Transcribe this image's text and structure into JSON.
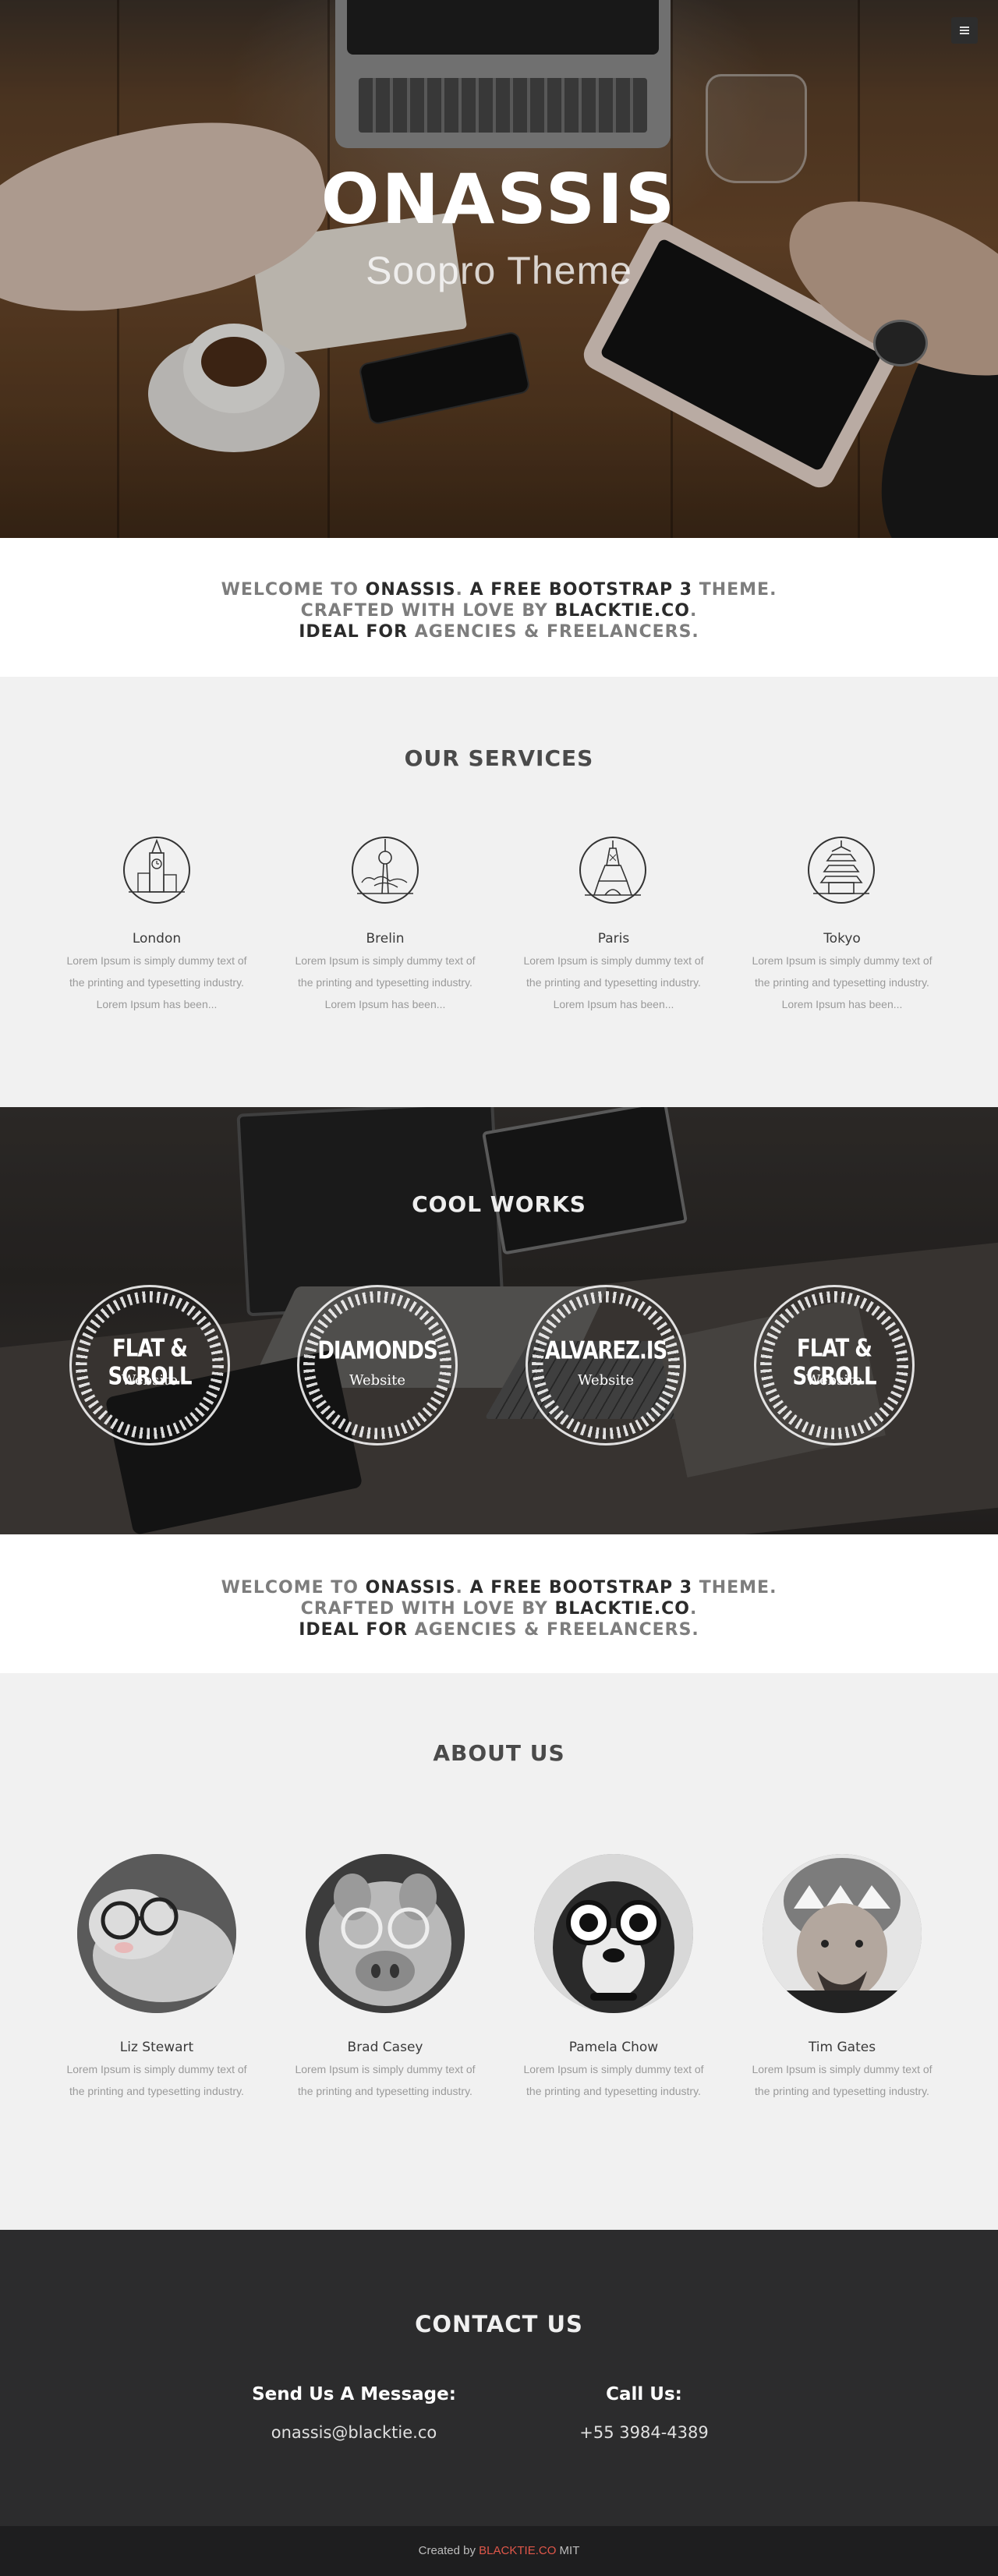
{
  "hero": {
    "title": "ONASSIS",
    "subtitle": "Soopro Theme",
    "menu_icon": "hamburger-icon"
  },
  "welcome": {
    "line1_a": "WELCOME TO ",
    "line1_b": "ONASSIS",
    "line1_c": ". ",
    "line1_d": "A FREE BOOTSTRAP 3",
    "line1_e": " THEME.",
    "line2_a": "CRAFTED WITH LOVE BY ",
    "line2_b": "BLACKTIE.CO",
    "line2_c": ".",
    "line3_a": "IDEAL FOR",
    "line3_b": " AGENCIES & FREELANCERS."
  },
  "services": {
    "title": "OUR SERVICES",
    "items": [
      {
        "name": "London",
        "icon": "big-ben-icon",
        "desc": "Lorem Ipsum is simply dummy text of the printing and typesetting industry. Lorem Ipsum has been..."
      },
      {
        "name": "Brelin",
        "icon": "tv-tower-icon",
        "desc": "Lorem Ipsum is simply dummy text of the printing and typesetting industry. Lorem Ipsum has been..."
      },
      {
        "name": "Paris",
        "icon": "eiffel-tower-icon",
        "desc": "Lorem Ipsum is simply dummy text of the printing and typesetting industry. Lorem Ipsum has been..."
      },
      {
        "name": "Tokyo",
        "icon": "pagoda-icon",
        "desc": "Lorem Ipsum is simply dummy text of the printing and typesetting industry. Lorem Ipsum has been..."
      }
    ]
  },
  "works": {
    "title": "COOL WORKS",
    "items": [
      {
        "title": "FLAT & SCROLL",
        "subtitle": "Website"
      },
      {
        "title": "DIAMONDS",
        "subtitle": "Website"
      },
      {
        "title": "ALVAREZ.IS",
        "subtitle": "Website"
      },
      {
        "title": "FLAT & SCROLL",
        "subtitle": "Website"
      }
    ]
  },
  "about": {
    "title": "ABOUT US",
    "members": [
      {
        "name": "Liz Stewart",
        "desc": "Lorem Ipsum is simply dummy text of the printing and typesetting industry."
      },
      {
        "name": "Brad Casey",
        "desc": "Lorem Ipsum is simply dummy text of the printing and typesetting industry."
      },
      {
        "name": "Pamela Chow",
        "desc": "Lorem Ipsum is simply dummy text of the printing and typesetting industry."
      },
      {
        "name": "Tim Gates",
        "desc": "Lorem Ipsum is simply dummy text of the printing and typesetting industry."
      }
    ]
  },
  "contact": {
    "title": "CONTACT US",
    "message_label": "Send Us A Message:",
    "email": "onassis@blacktie.co",
    "call_label": "Call Us:",
    "phone": "+55 3984-4389"
  },
  "footer": {
    "prefix": "Created by ",
    "brand": "BLACKTIE.CO",
    "suffix": " MIT"
  },
  "colors": {
    "accent": "#e0574a",
    "dark": "#2c2c2d",
    "light_grey": "#f1f1f1"
  }
}
